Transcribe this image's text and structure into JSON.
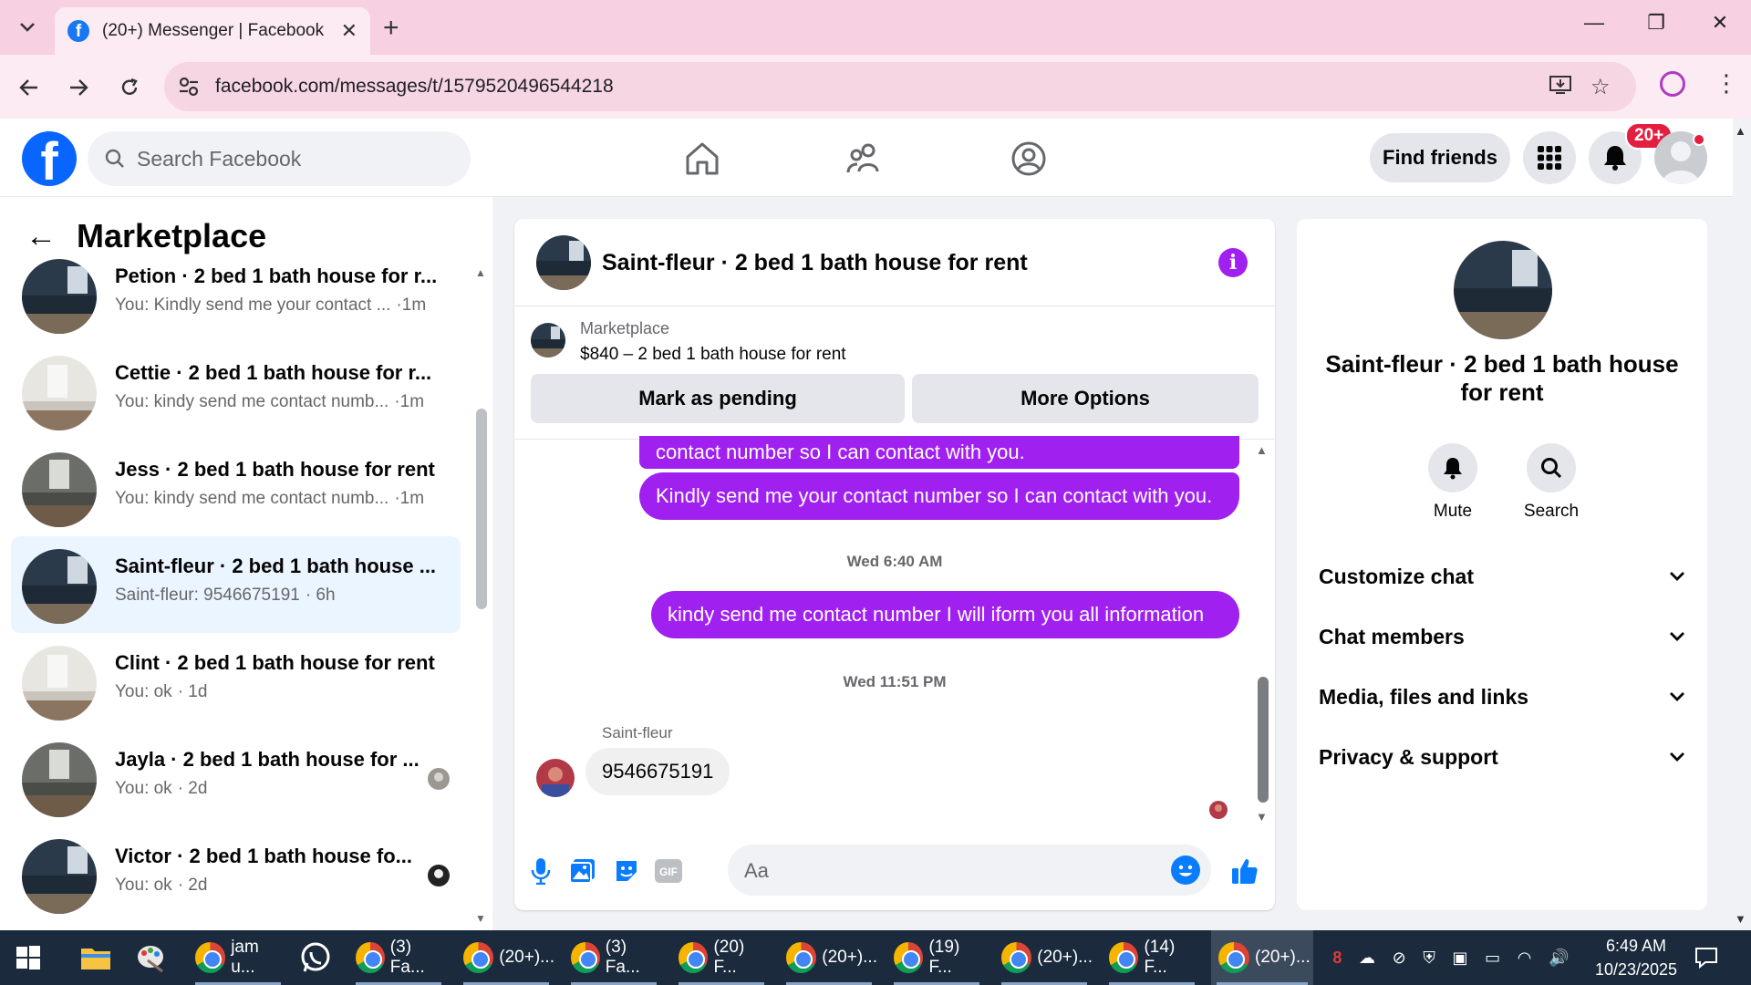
{
  "browser": {
    "tab_title": "(20+) Messenger | Facebook",
    "url": "facebook.com/messages/t/1579520496544218"
  },
  "fb_header": {
    "search_placeholder": "Search Facebook",
    "find_friends_label": "Find friends",
    "notification_count": "20+"
  },
  "left_pane": {
    "title": "Marketplace",
    "conversations": [
      {
        "name": "Petion · 2 bed 1 bath house for r...",
        "preview": "You: Kindly send me your contact ...",
        "time": "·1m"
      },
      {
        "name": "Cettie · 2 bed 1 bath house for r...",
        "preview": "You: kindy send me contact numb...",
        "time": "·1m"
      },
      {
        "name": "Jess · 2 bed 1 bath house for rent",
        "preview": "You: kindy send me contact numb...",
        "time": "·1m"
      },
      {
        "name": "Saint-fleur · 2 bed 1 bath house ...",
        "preview": "Saint-fleur: 9546675191",
        "time": "· 6h"
      },
      {
        "name": "Clint · 2 bed 1 bath house for rent",
        "preview": "You: ok",
        "time": "· 1d"
      },
      {
        "name": "Jayla · 2 bed 1 bath house for ...",
        "preview": "You: ok",
        "time": "· 2d"
      },
      {
        "name": "Victor · 2 bed 1 bath house fo...",
        "preview": "You: ok",
        "time": "· 2d"
      }
    ]
  },
  "chat": {
    "title": "Saint-fleur · 2 bed 1 bath house for rent",
    "listing_source": "Marketplace",
    "listing_desc": "$840 – 2 bed 1 bath house for rent",
    "mark_pending_label": "Mark as pending",
    "more_options_label": "More Options",
    "messages": {
      "out_1_partial": "contact number so I can contact with you.",
      "out_2": "Kindly send me your contact number so I can contact with you.",
      "timestamp_1": "Wed 6:40 AM",
      "out_3": "kindy send me contact number I will iform you all information",
      "timestamp_2": "Wed 11:51 PM",
      "in_sender": "Saint-fleur",
      "in_1": "9546675191"
    },
    "input_placeholder": "Aa"
  },
  "info_pane": {
    "name": "Saint-fleur · 2 bed 1 bath house for rent",
    "mute_label": "Mute",
    "search_label": "Search",
    "sections": [
      "Customize chat",
      "Chat members",
      "Media, files and links",
      "Privacy & support"
    ]
  },
  "taskbar": {
    "items": [
      "jam u...",
      "(3) Fa...",
      "(20+)...",
      "(3) Fa...",
      "(20) F...",
      "(20+)...",
      "(19) F...",
      "(20+)...",
      "(14) F...",
      "(20+)..."
    ],
    "time": "6:49 AM",
    "date": "10/23/2025"
  },
  "colors": {
    "fb_blue": "#0866ff",
    "messenger_purple": "#a020f0",
    "tab_pink": "#f7d0e1",
    "taskbar": "#1b2a3c"
  }
}
